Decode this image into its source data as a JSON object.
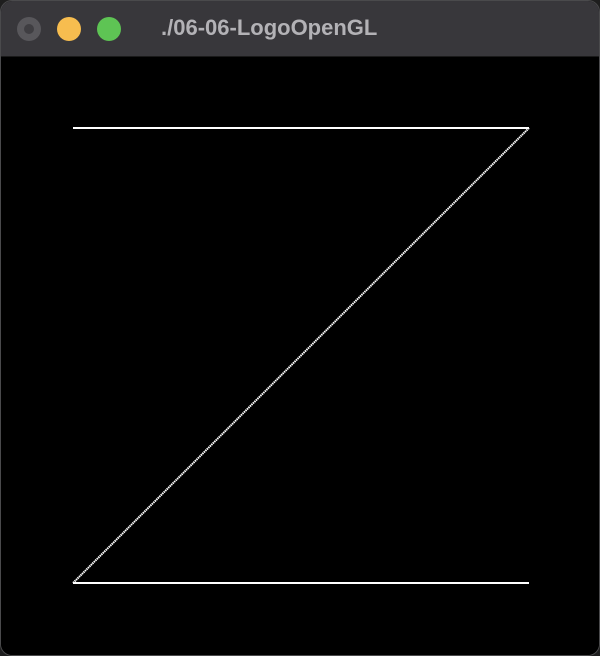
{
  "window": {
    "title": "./06-06-LogoOpenGL",
    "controls": {
      "close_icon": "close-icon",
      "minimize_icon": "minimize-icon",
      "zoom_icon": "zoom-icon"
    }
  },
  "canvas": {
    "background_color": "#000000",
    "stroke_color": "#ffffff",
    "drawing": "Z-shaped line figure"
  }
}
